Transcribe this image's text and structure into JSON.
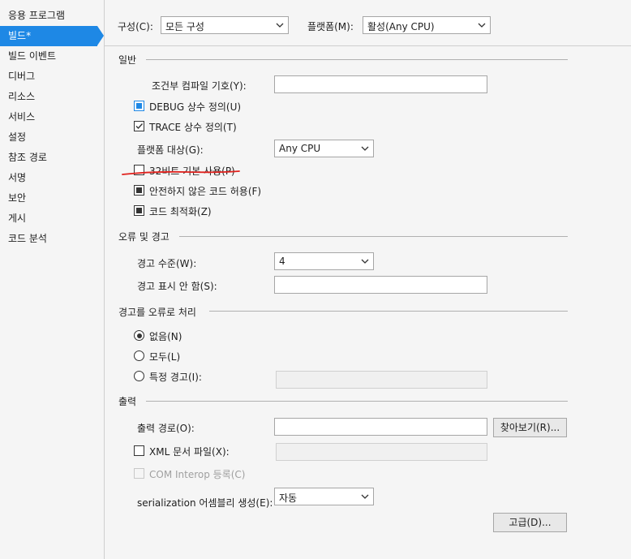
{
  "sidebar": {
    "items": [
      {
        "label": "응용 프로그램",
        "active": false
      },
      {
        "label": "빌드*",
        "active": true
      },
      {
        "label": "빌드 이벤트",
        "active": false
      },
      {
        "label": "디버그",
        "active": false
      },
      {
        "label": "리소스",
        "active": false
      },
      {
        "label": "서비스",
        "active": false
      },
      {
        "label": "설정",
        "active": false
      },
      {
        "label": "참조 경로",
        "active": false
      },
      {
        "label": "서명",
        "active": false
      },
      {
        "label": "보안",
        "active": false
      },
      {
        "label": "게시",
        "active": false
      },
      {
        "label": "코드 분석",
        "active": false
      }
    ],
    "active_color": "#1e88e5"
  },
  "topbar": {
    "config_label": "구성(C):",
    "config_value": "모든 구성",
    "platform_label": "플랫폼(M):",
    "platform_value": "활성(Any CPU)"
  },
  "general": {
    "title": "일반",
    "conditional_symbols_label": "조건부 컴파일 기호(Y):",
    "conditional_symbols_value": "",
    "debug_label": "DEBUG 상수 정의(U)",
    "debug_state": "indeterminate",
    "trace_label": "TRACE 상수 정의(T)",
    "trace_state": "checked",
    "platform_target_label": "플랫폼 대상(G):",
    "platform_target_value": "Any CPU",
    "prefer32_label": "32비트 기본 사용(P)",
    "prefer32_state": "unchecked",
    "unsafe_label": "안전하지 않은 코드 허용(F)",
    "unsafe_state": "indeterminate",
    "optimize_label": "코드 최적화(Z)",
    "optimize_state": "indeterminate",
    "annotation_color": "#e0201c"
  },
  "errors": {
    "title": "오류 및 경고",
    "warning_level_label": "경고 수준(W):",
    "warning_level_value": "4",
    "suppress_label": "경고 표시 안 함(S):",
    "suppress_value": ""
  },
  "treat_warnings": {
    "title": "경고를 오류로 처리",
    "none_label": "없음(N)",
    "all_label": "모두(L)",
    "specific_label": "특정 경고(I):",
    "selected": "none",
    "specific_value": ""
  },
  "output": {
    "title": "출력",
    "path_label": "출력 경로(O):",
    "path_value": "",
    "browse_label": "찾아보기(R)...",
    "xml_label": "XML 문서 파일(X):",
    "xml_state": "unchecked",
    "xml_value": "",
    "com_label": "COM Interop 등록(C)",
    "com_state": "disabled",
    "serialization_label": "serialization 어셈블리 생성(E):",
    "serialization_value": "자동",
    "advanced_label": "고급(D)..."
  }
}
